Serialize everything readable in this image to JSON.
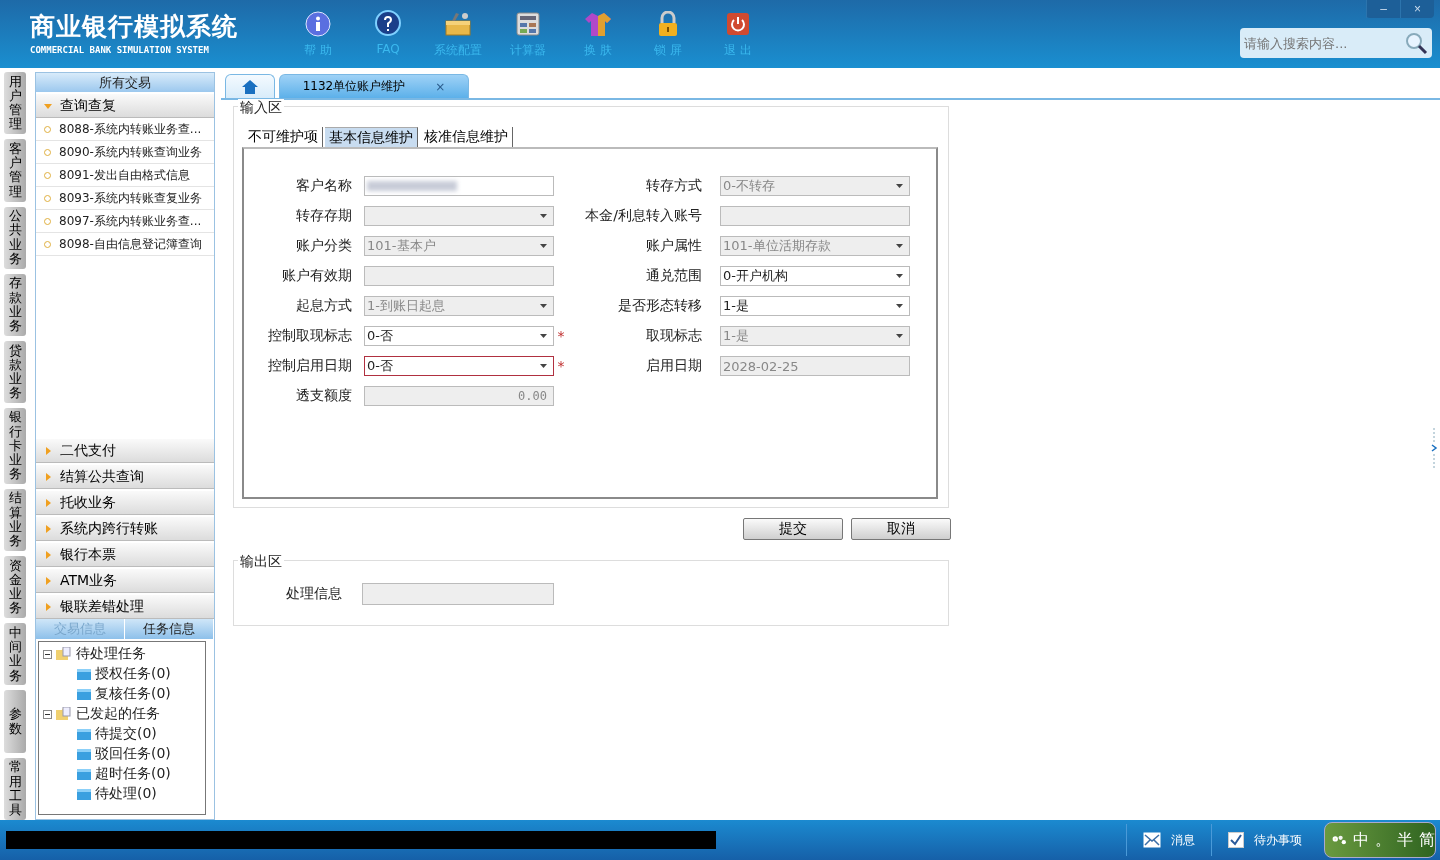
{
  "header": {
    "title": "商业银行模拟系统",
    "subtitle": "COMMERCIAL BANK SIMULATION SYSTEM",
    "tools": [
      {
        "kind": "help",
        "label": "帮 助"
      },
      {
        "kind": "faq",
        "label": "FAQ"
      },
      {
        "kind": "config",
        "label": "系统配置"
      },
      {
        "kind": "calculator",
        "label": "计算器"
      },
      {
        "kind": "skin",
        "label": "换 肤"
      },
      {
        "kind": "lock",
        "label": "锁 屏"
      },
      {
        "kind": "exit",
        "label": "退 出"
      }
    ],
    "window_controls": [
      "–",
      "×"
    ],
    "search": {
      "placeholder": "请输入搜索内容..."
    }
  },
  "side_tabs": [
    "用户管理",
    "客户管理",
    "公共业务",
    "存款业务",
    "贷款业务",
    "银行卡业务",
    "结算业务",
    "资金业务",
    "中间业务",
    "参数",
    "常用工具"
  ],
  "sidebar": {
    "title": "所有交易",
    "sections": [
      {
        "label": "查询查复",
        "expanded": true,
        "items": [
          "8088-系统内转账业务查...",
          "8090-系统内转账查询业务",
          "8091-发出自由格式信息",
          "8093-系统内转账查复业务",
          "8097-系统内转账业务查...",
          "8098-自由信息登记簿查询"
        ]
      },
      {
        "label": "二代支付",
        "expanded": false
      },
      {
        "label": "结算公共查询",
        "expanded": false
      },
      {
        "label": "托收业务",
        "expanded": false
      },
      {
        "label": "系统内跨行转账",
        "expanded": false
      },
      {
        "label": "银行本票",
        "expanded": false
      },
      {
        "label": "ATM业务",
        "expanded": false
      },
      {
        "label": "银联差错处理",
        "expanded": false
      }
    ],
    "bottom_tabs": [
      {
        "label": "交易信息",
        "selected": false
      },
      {
        "label": "任务信息",
        "selected": true
      }
    ],
    "tree": [
      {
        "label": "待处理任务",
        "expanded": true,
        "children": [
          {
            "label": "授权任务(0)"
          },
          {
            "label": "复核任务(0)"
          }
        ]
      },
      {
        "label": "已发起的任务",
        "expanded": true,
        "children": [
          {
            "label": "待提交(0)"
          },
          {
            "label": "驳回任务(0)"
          },
          {
            "label": "超时任务(0)"
          },
          {
            "label": "待处理(0)"
          }
        ]
      }
    ]
  },
  "tabs": [
    {
      "kind": "home",
      "selected": false
    },
    {
      "kind": "page",
      "label": "1132单位账户维护",
      "close": "×",
      "selected": true
    }
  ],
  "input_area": {
    "title": "输入区",
    "subtabs": [
      {
        "label": "不可维护项",
        "selected": false
      },
      {
        "label": "基本信息维护",
        "selected": true
      },
      {
        "label": "核准信息维护",
        "selected": false
      }
    ],
    "rows": [
      {
        "fields": [
          {
            "label": "客户名称",
            "kind": "blurred",
            "disabled": false
          },
          {
            "label": "转存方式",
            "kind": "select",
            "value": "0-不转存",
            "disabled": true
          }
        ]
      },
      {
        "fields": [
          {
            "label": "转存存期",
            "kind": "select",
            "disabled": true
          },
          {
            "label": "本金/利息转入账号",
            "kind": "text",
            "disabled": true
          }
        ]
      },
      {
        "fields": [
          {
            "label": "账户分类",
            "kind": "select",
            "value": "101-基本户",
            "disabled": true
          },
          {
            "label": "账户属性",
            "kind": "select",
            "value": "101-单位活期存款",
            "disabled": true
          }
        ]
      },
      {
        "fields": [
          {
            "label": "账户有效期",
            "kind": "text",
            "disabled": true
          },
          {
            "label": "通兑范围",
            "kind": "select",
            "value": "0-开户机构",
            "disabled": false
          }
        ]
      },
      {
        "fields": [
          {
            "label": "起息方式",
            "kind": "select",
            "value": "1-到账日起息",
            "disabled": true
          },
          {
            "label": "是否形态转移",
            "kind": "select",
            "value": "1-是",
            "disabled": false
          }
        ]
      },
      {
        "fields": [
          {
            "label": "控制取现标志",
            "kind": "select",
            "value": "0-否",
            "disabled": false,
            "required": "*"
          },
          {
            "label": "取现标志",
            "kind": "select",
            "value": "1-是",
            "disabled": true
          }
        ]
      },
      {
        "fields": [
          {
            "label": "控制启用日期",
            "kind": "select",
            "value": "0-否",
            "disabled": false,
            "focused": true,
            "required": "*"
          },
          {
            "label": "启用日期",
            "kind": "text",
            "value": "2028-02-25",
            "disabled": true
          }
        ]
      },
      {
        "fields": [
          {
            "label": "透支额度",
            "kind": "amount",
            "value": "0.00",
            "disabled": true
          }
        ]
      }
    ]
  },
  "buttons": [
    "提交",
    "取消"
  ],
  "output_area": {
    "title": "输出区",
    "fields": [
      {
        "label": "处理信息",
        "disabled": true
      }
    ]
  },
  "status_bar": {
    "items": [
      {
        "kind": "message",
        "label": "消息"
      },
      {
        "kind": "todo",
        "label": "待办事项"
      }
    ],
    "ime": [
      "中",
      "。",
      "半",
      "简"
    ]
  }
}
